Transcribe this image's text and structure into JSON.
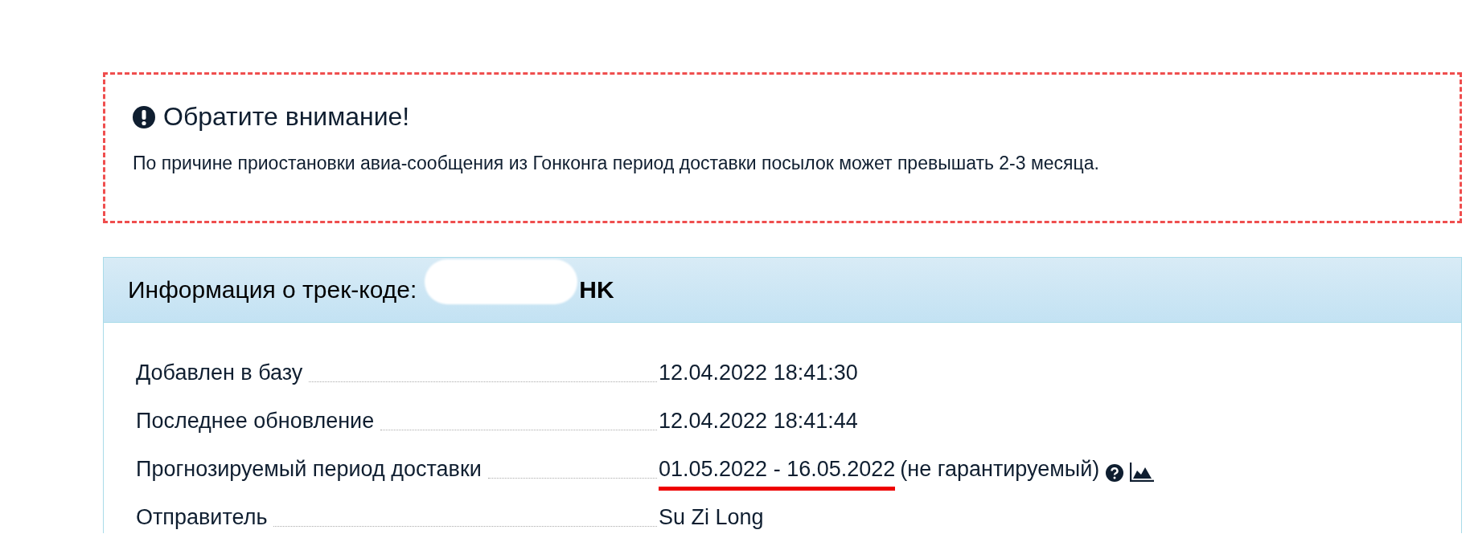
{
  "notice": {
    "title": "Обратите внимание!",
    "text": "По причине приостановки авиа-сообщения из Гонконга период доставки посылок может превышать 2-3 месяца."
  },
  "tracking": {
    "heading": "Информация о трек-коде:",
    "code_visible": "HK",
    "redacted": true,
    "rows": [
      {
        "kind": "plain",
        "label": "Добавлен в базу",
        "value": "12.04.2022 18:41:30"
      },
      {
        "kind": "plain",
        "label": "Последнее обновление",
        "value": "12.04.2022 18:41:44"
      },
      {
        "kind": "forecast",
        "label": "Прогнозируемый период доставки",
        "value": "01.05.2022 - 16.05.2022",
        "note": "(не гарантируемый)",
        "underlined": true
      },
      {
        "kind": "plain",
        "label": "Отправитель",
        "value": "Su Zi Long"
      }
    ]
  }
}
